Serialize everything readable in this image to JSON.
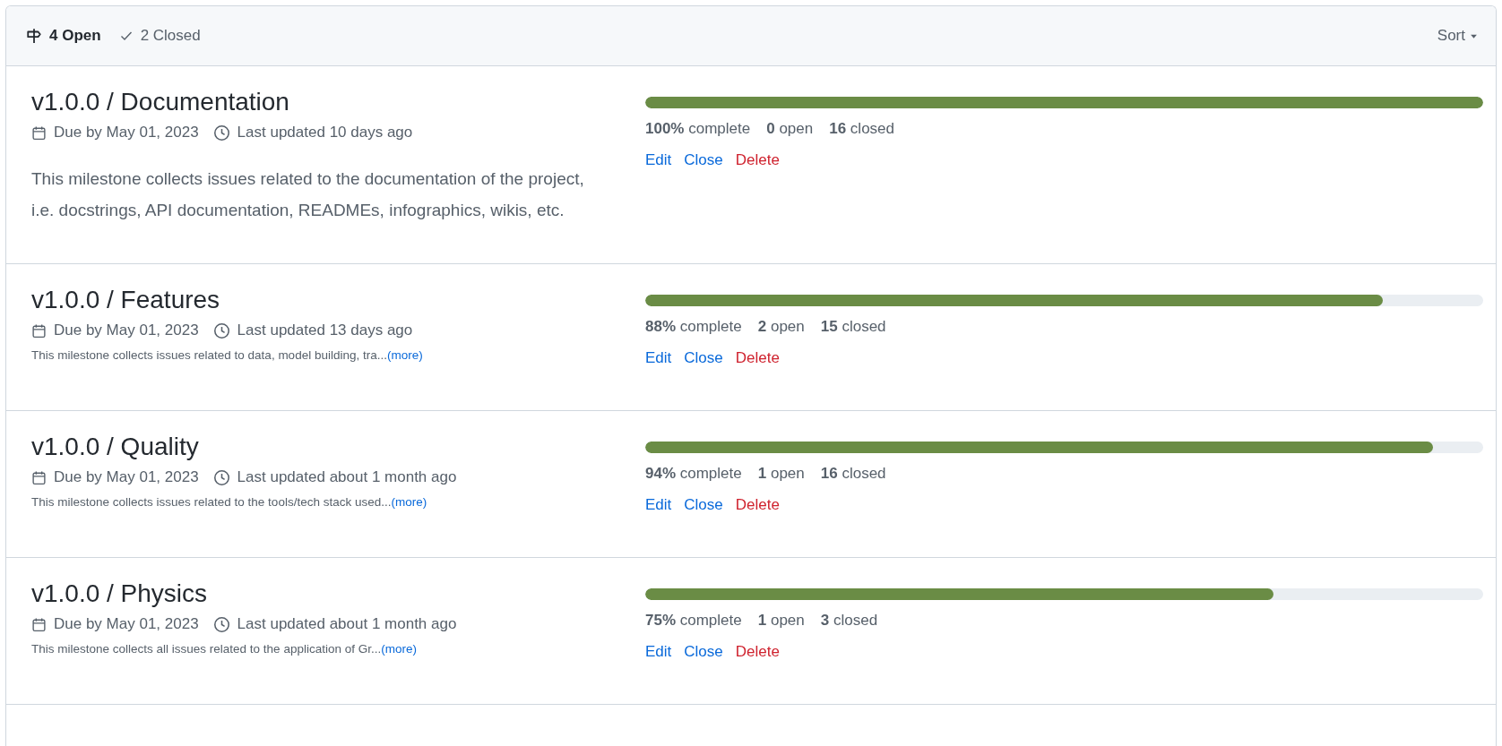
{
  "header": {
    "tabs": [
      {
        "label": "4 Open",
        "selected": true,
        "kind": "open"
      },
      {
        "label": "2 Closed",
        "selected": false,
        "kind": "closed"
      }
    ],
    "sort": {
      "label": "Sort"
    }
  },
  "milestones": [
    {
      "title": "v1.0.0 / Documentation",
      "due": "Due by May 01, 2023",
      "updated": "Last updated 10 days ago",
      "description": {
        "kind": "full",
        "text": "This milestone collects issues related to the documentation of the project, i.e. docstrings, API documentation, READMEs, infographics, wikis, etc."
      },
      "level": 1,
      "stats": [
        "**100%** complete",
        "**0** open",
        "**16** closed"
      ],
      "actions": [
        {
          "label": "Edit",
          "kind": "normal"
        },
        {
          "label": "Close",
          "kind": "normal"
        },
        {
          "label": "Delete",
          "kind": "danger"
        }
      ]
    },
    {
      "title": "v1.0.0 / Features",
      "due": "Due by May 01, 2023",
      "updated": "Last updated 13 days ago",
      "description": {
        "kind": "short",
        "text": "This milestone collects issues related to data, model building, tra...",
        "more": "(more)"
      },
      "level": 0.88,
      "stats": [
        "**88%** complete",
        "**2** open",
        "**15** closed"
      ],
      "actions": [
        {
          "label": "Edit",
          "kind": "normal"
        },
        {
          "label": "Close",
          "kind": "normal"
        },
        {
          "label": "Delete",
          "kind": "danger"
        }
      ]
    },
    {
      "title": "v1.0.0 / Quality",
      "due": "Due by May 01, 2023",
      "updated": "Last updated about 1 month ago",
      "description": {
        "kind": "short",
        "text": "This milestone collects issues related to the tools/tech stack used...",
        "more": "(more)"
      },
      "level": 0.94,
      "stats": [
        "**94%** complete",
        "**1** open",
        "**16** closed"
      ],
      "actions": [
        {
          "label": "Edit",
          "kind": "normal"
        },
        {
          "label": "Close",
          "kind": "normal"
        },
        {
          "label": "Delete",
          "kind": "danger"
        }
      ]
    },
    {
      "title": "v1.0.0 / Physics",
      "due": "Due by May 01, 2023",
      "updated": "Last updated about 1 month ago",
      "description": {
        "kind": "short",
        "text": "This milestone collects all issues related to the application of Gr...",
        "more": "(more)"
      },
      "level": 0.75,
      "stats": [
        "**75%** complete",
        "**1** open",
        "**3** closed"
      ],
      "actions": [
        {
          "label": "Edit",
          "kind": "normal"
        },
        {
          "label": "Close",
          "kind": "normal"
        },
        {
          "label": "Delete",
          "kind": "danger"
        }
      ]
    }
  ]
}
